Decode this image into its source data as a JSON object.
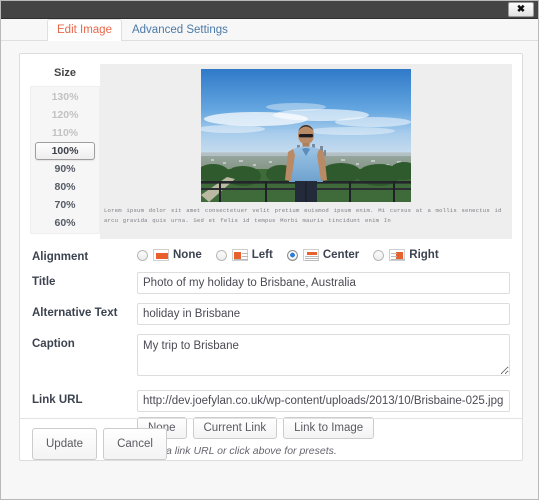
{
  "window": {
    "close_icon": "close-icon",
    "close_glyph": "✖"
  },
  "tabs": [
    {
      "label": "Edit Image",
      "active": true
    },
    {
      "label": "Advanced Settings",
      "active": false
    }
  ],
  "preview": {
    "size_heading": "Size",
    "size_options": [
      {
        "label": "130%",
        "state": "disabled"
      },
      {
        "label": "120%",
        "state": "disabled"
      },
      {
        "label": "110%",
        "state": "disabled"
      },
      {
        "label": "100%",
        "state": "selected"
      },
      {
        "label": "90%",
        "state": "normal"
      },
      {
        "label": "80%",
        "state": "normal"
      },
      {
        "label": "70%",
        "state": "normal"
      },
      {
        "label": "60%",
        "state": "normal"
      }
    ],
    "image_alt": "Photo of a man in a blue t-shirt and sunglasses standing at a lookout above a city skyline",
    "lorem_text": "Lorem ipsum dolor sit amet consectetuer velit pretium euismod ipsum enim. Mi cursus at a mollis senectus id arcu gravida quis urna. Sed et felis id tempus Morbi mauris tincidunt enim In"
  },
  "form": {
    "alignment": {
      "label": "Alignment",
      "options": [
        {
          "label": "None",
          "icon": "align-none-icon",
          "checked": false
        },
        {
          "label": "Left",
          "icon": "align-left-icon",
          "checked": false
        },
        {
          "label": "Center",
          "icon": "align-center-icon",
          "checked": true
        },
        {
          "label": "Right",
          "icon": "align-right-icon",
          "checked": false
        }
      ]
    },
    "title": {
      "label": "Title",
      "value": "Photo of my holiday to Brisbane, Australia"
    },
    "alt_text": {
      "label": "Alternative Text",
      "value": "holiday in Brisbane"
    },
    "caption": {
      "label": "Caption",
      "value": "My trip to Brisbane"
    },
    "link_url": {
      "label": "Link URL",
      "value": "http://dev.joefylan.co.uk/wp-content/uploads/2013/10/Brisbaine-025.jpg"
    },
    "link_presets": [
      {
        "label": "None"
      },
      {
        "label": "Current Link"
      },
      {
        "label": "Link to Image"
      }
    ],
    "link_hint": "Enter a link URL or click above for presets."
  },
  "footer": {
    "update_label": "Update",
    "cancel_label": "Cancel"
  },
  "colors": {
    "accent": "#e8684a",
    "align_marker": "#e8602c",
    "radio_checked": "#2c7fd4",
    "titlebar": "#444444",
    "link": "#4a7aa7"
  }
}
